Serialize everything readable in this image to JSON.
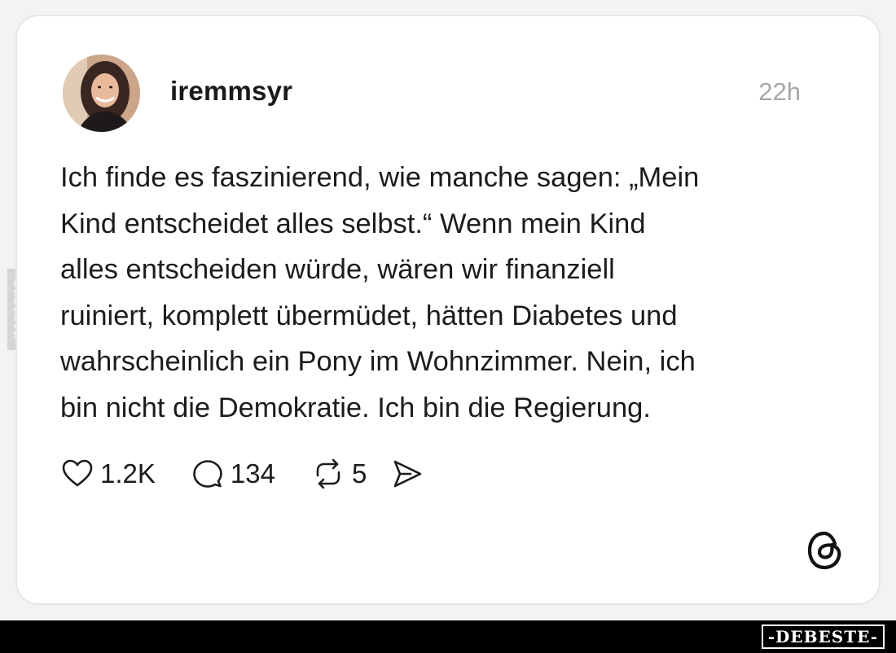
{
  "post": {
    "username": "iremmsyr",
    "timestamp": "22h",
    "text": "Ich finde es faszinierend, wie manche sagen: „Mein\nKind entscheidet alles selbst.“ Wenn mein Kind\nalles entscheiden würde, wären wir finanziell\nruiniert, komplett übermüdet, hätten Diabetes und\nwahrscheinlich ein Pony im Wohnzimmer. Nein, ich\nbin nicht die Demokratie. Ich bin die Regierung.",
    "actions": {
      "likes": {
        "icon": "heart-icon",
        "count": "1.2K"
      },
      "replies": {
        "icon": "comment-icon",
        "count": "134"
      },
      "reposts": {
        "icon": "repost-icon",
        "count": "5"
      },
      "share": {
        "icon": "send-icon"
      }
    },
    "platform_icon": "threads-logo-icon"
  },
  "watermark": {
    "side": "DEBESTE",
    "footer": "-DEBESTE-"
  },
  "colors": {
    "background": "#f3f3f3",
    "card": "#ffffff",
    "text": "#1c1c1c",
    "muted": "#a6a6a6",
    "footer": "#000000"
  }
}
